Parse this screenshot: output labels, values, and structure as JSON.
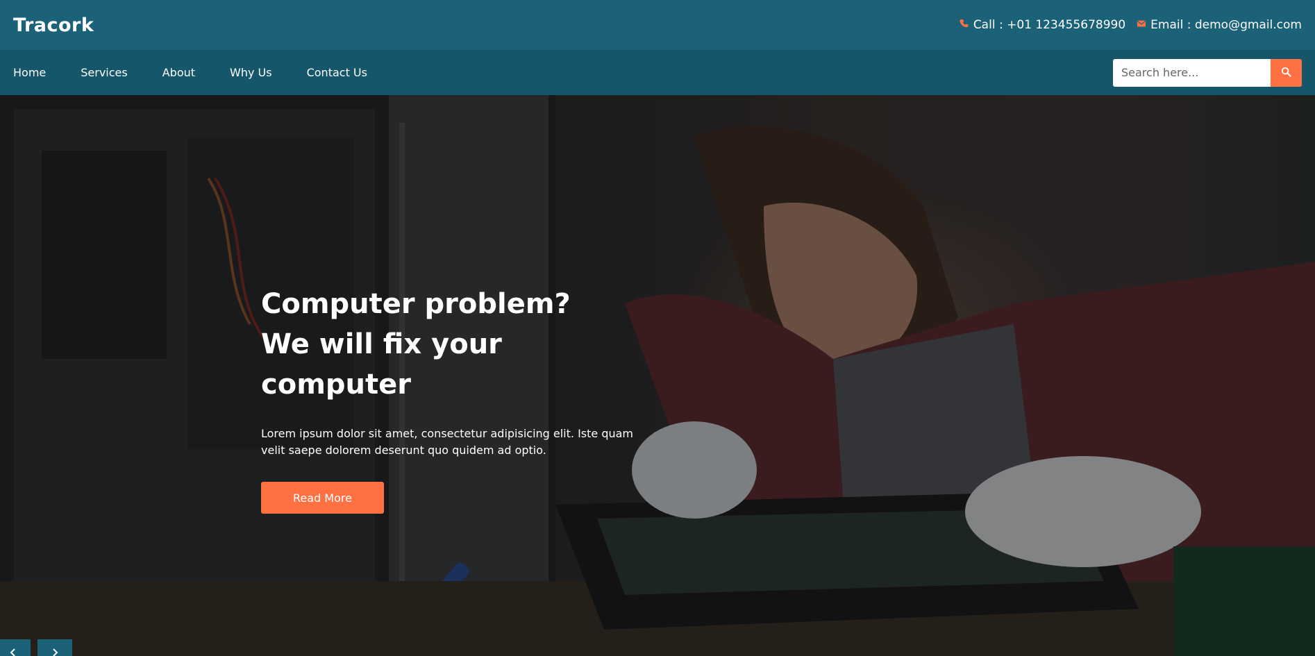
{
  "brand": {
    "name": "Tracork"
  },
  "contact": {
    "call": "Call : +01 123455678990",
    "email": "Email : demo@gmail.com",
    "call_icon": "phone-icon",
    "email_icon": "envelope-icon"
  },
  "nav": {
    "items": [
      {
        "label": "Home"
      },
      {
        "label": "Services"
      },
      {
        "label": "About"
      },
      {
        "label": "Why Us"
      },
      {
        "label": "Contact Us"
      }
    ]
  },
  "search": {
    "placeholder": "Search here...",
    "value": "",
    "icon": "search-icon"
  },
  "hero": {
    "title_line1": "Computer problem?",
    "title_line2": "We will fix your computer",
    "text": "Lorem ipsum dolor sit amet, consectetur adipisicing elit. Iste quam velit saepe dolorem deserunt quo quidem ad optio.",
    "button_label": "Read More"
  },
  "carousel": {
    "prev_icon": "chevron-left-icon",
    "next_icon": "chevron-right-icon"
  },
  "colors": {
    "topbar": "#1b6278",
    "navbar": "#16566a",
    "accent": "#ff7043",
    "text": "#ffffff"
  }
}
